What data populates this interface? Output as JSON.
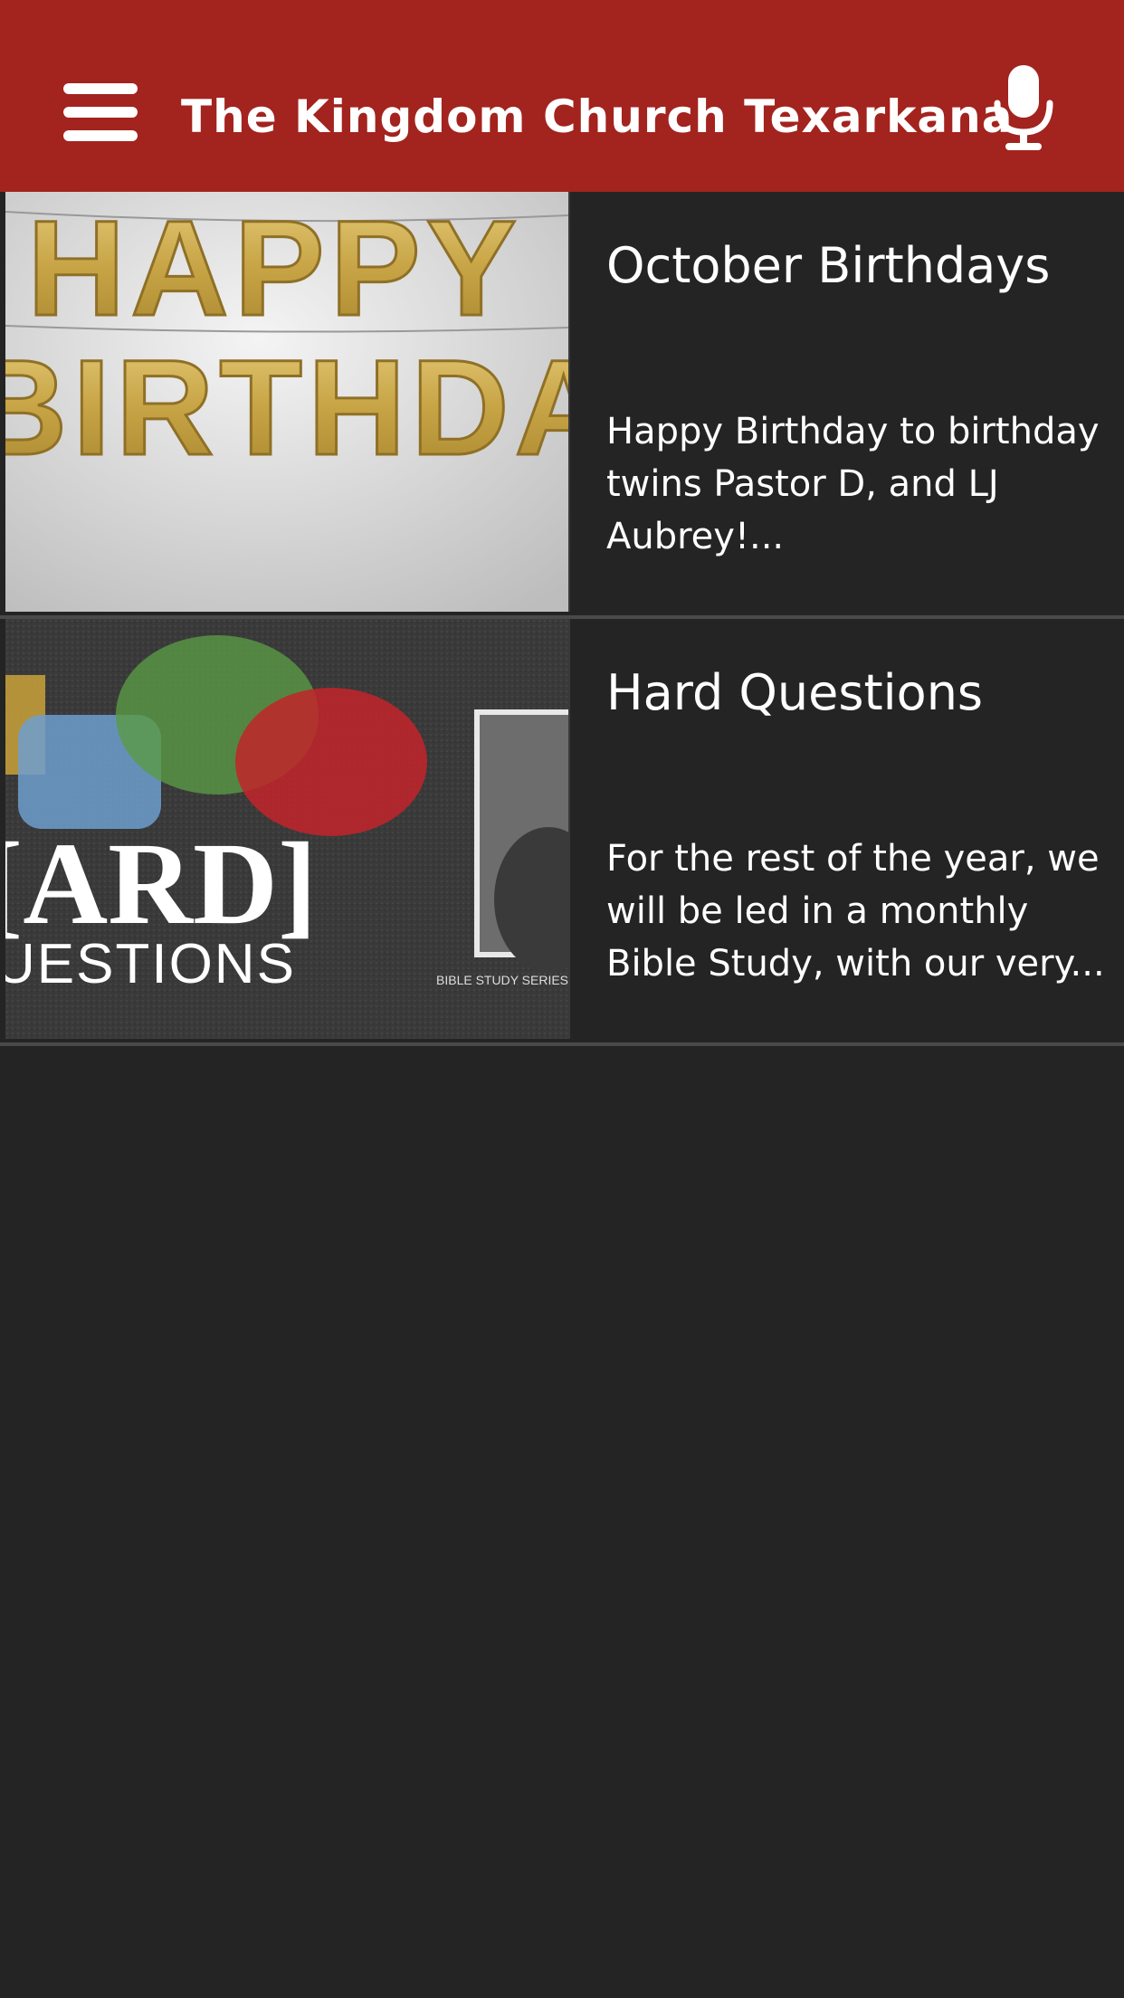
{
  "header": {
    "title": "The Kingdom Church Texarkana",
    "menu_icon": "hamburger-menu-icon",
    "mic_icon": "microphone-icon",
    "background_color": "#a3231e"
  },
  "feed": {
    "items": [
      {
        "title": "October Birthdays",
        "excerpt": "Happy Birthday to birthday twins Pastor D, and LJ Aubrey!...",
        "image_text": "HAPPY BIRTHDAY"
      },
      {
        "title": "Hard Questions",
        "excerpt": "For the rest of the year, we will be led in a monthly Bible Study, with our very...",
        "image_text_main": "HARD",
        "image_text_sub": "QUESTIONS",
        "image_caption": "BIBLE STUDY SERIES LEA"
      }
    ]
  },
  "colors": {
    "background": "#242424",
    "divider": "#4a4a4a",
    "text": "#ffffff"
  }
}
